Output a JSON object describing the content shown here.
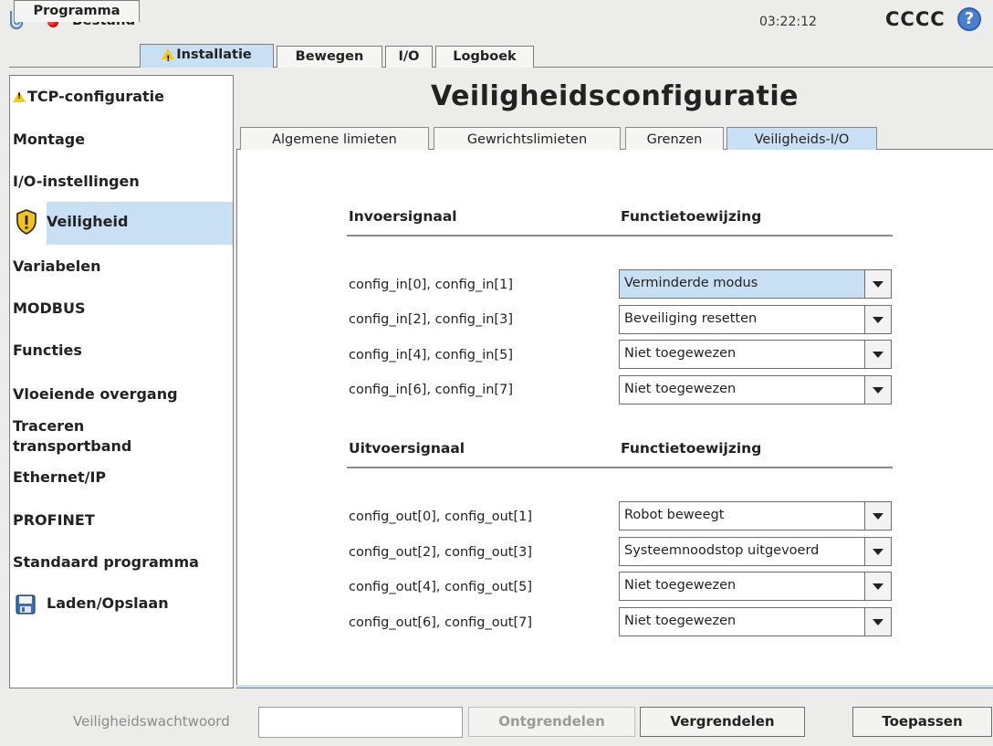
{
  "topbar": {
    "file_menu": "Bestand",
    "time": "03:22:12",
    "robot_name": "CCCC",
    "help_glyph": "?"
  },
  "main_tabs": [
    {
      "label": "Programma",
      "active": false,
      "warning": false
    },
    {
      "label": "Installatie",
      "active": true,
      "warning": true
    },
    {
      "label": "Bewegen",
      "active": false,
      "warning": false
    },
    {
      "label": "I/O",
      "active": false,
      "warning": false
    },
    {
      "label": "Logboek",
      "active": false,
      "warning": false
    }
  ],
  "sidebar": {
    "items": [
      {
        "label": "TCP-configuratie",
        "icon": "warning-icon",
        "active": false
      },
      {
        "label": "Montage",
        "active": false
      },
      {
        "label": "I/O-instellingen",
        "active": false
      },
      {
        "label": "Veiligheid",
        "icon": "shield-warning-icon",
        "active": true
      },
      {
        "label": "Variabelen",
        "active": false
      },
      {
        "label": "MODBUS",
        "active": false
      },
      {
        "label": "Functies",
        "active": false
      },
      {
        "label": "Vloeiende overgang",
        "active": false
      },
      {
        "label": "Traceren transportband",
        "active": false
      },
      {
        "label": "Ethernet/IP",
        "active": false
      },
      {
        "label": "PROFINET",
        "active": false
      },
      {
        "label": "Standaard programma",
        "active": false
      },
      {
        "label": "Laden/Opslaan",
        "icon": "save-disk-icon",
        "active": false
      }
    ]
  },
  "page_title": "Veiligheidsconfiguratie",
  "sub_tabs": [
    {
      "label": "Algemene limieten",
      "active": false
    },
    {
      "label": "Gewrichtslimieten",
      "active": false
    },
    {
      "label": "Grenzen",
      "active": false
    },
    {
      "label": "Veiligheids-I/O",
      "active": true
    }
  ],
  "inputs": {
    "signal_header": "Invoersignaal",
    "function_header": "Functietoewijzing",
    "rows": [
      {
        "signal": "config_in[0], config_in[1]",
        "function": "Verminderde modus",
        "selected": true
      },
      {
        "signal": "config_in[2], config_in[3]",
        "function": "Beveiliging resetten",
        "selected": false
      },
      {
        "signal": "config_in[4], config_in[5]",
        "function": "Niet toegewezen",
        "selected": false
      },
      {
        "signal": "config_in[6], config_in[7]",
        "function": "Niet toegewezen",
        "selected": false
      }
    ]
  },
  "outputs": {
    "signal_header": "Uitvoersignaal",
    "function_header": "Functietoewijzing",
    "rows": [
      {
        "signal": "config_out[0], config_out[1]",
        "function": "Robot beweegt",
        "selected": false
      },
      {
        "signal": "config_out[2], config_out[3]",
        "function": "Systeemnoodstop uitgevoerd",
        "selected": false
      },
      {
        "signal": "config_out[4], config_out[5]",
        "function": "Niet toegewezen",
        "selected": false
      },
      {
        "signal": "config_out[6], config_out[7]",
        "function": "Niet toegewezen",
        "selected": false
      }
    ]
  },
  "footer": {
    "password_label": "Veiligheidswachtwoord",
    "password_value": "",
    "unlock_label": "Ontgrendelen",
    "lock_label": "Vergrendelen",
    "apply_label": "Toepassen"
  },
  "colors": {
    "selection": "#c9dff3",
    "status_red": "#d21010",
    "warning_yellow": "#f2cc1a"
  }
}
